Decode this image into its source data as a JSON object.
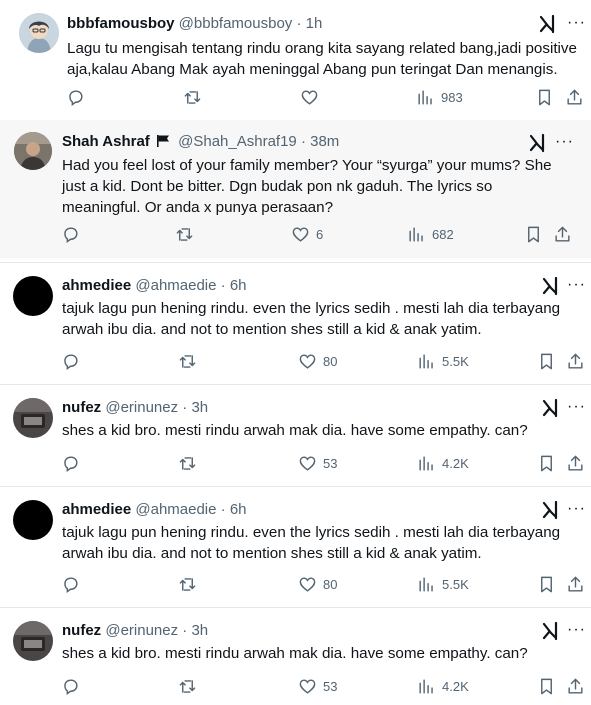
{
  "tweets": [
    {
      "name": "bbbfamousboy",
      "handle": "@bbbfamousboy",
      "time": "1h",
      "lines": [
        "Lagu tu mengisah tentang rindu orang kita sayang related bang,jadi positive",
        "aja,kalau Abang Mak ayah meninggal Abang pun teringat Dan menangis."
      ],
      "likes": "",
      "views": "983"
    },
    {
      "name": "Shah Ashraf",
      "handle": "@Shah_Ashraf19",
      "time": "38m",
      "lines": [
        "Had you feel lost of your family member? Your “syurga” your mums? She",
        "just a kid. Dont be bitter. Dgn budak pon nk gaduh. The lyrics so",
        "meaningful. Or anda x punya perasaan?"
      ],
      "likes": "6",
      "views": "682"
    },
    {
      "name": "ahmediee",
      "handle": "@ahmaedie",
      "time": "6h",
      "lines": [
        "tajuk lagu pun hening rindu. even the lyrics sedih . mesti lah dia terbayang",
        "arwah ibu dia. and not to mention shes still a kid & anak yatim."
      ],
      "likes": "80",
      "views": "5.5K"
    },
    {
      "name": "nufez",
      "handle": "@erinunez",
      "time": "3h",
      "lines": [
        "shes a kid bro. mesti rindu arwah mak dia. have some empathy. can?"
      ],
      "likes": "53",
      "views": "4.2K"
    },
    {
      "name": "ahmediee",
      "handle": "@ahmaedie",
      "time": "6h",
      "lines": [
        "tajuk lagu pun hening rindu. even the lyrics sedih . mesti lah dia terbayang",
        "arwah ibu dia. and not to mention shes still a kid & anak yatim."
      ],
      "likes": "80",
      "views": "5.5K"
    },
    {
      "name": "nufez",
      "handle": "@erinunez",
      "time": "3h",
      "lines": [
        "shes a kid bro. mesti rindu arwah mak dia. have some empathy. can?"
      ],
      "likes": "53",
      "views": "4.2K"
    }
  ],
  "separator": "·",
  "more_symbol": "···",
  "icons": {
    "reply": "reply-icon",
    "retweet": "retweet-icon",
    "like": "like-icon",
    "views": "views-icon",
    "bookmark": "bookmark-icon",
    "share": "share-icon",
    "grok": "grok-icon",
    "more": "more-icon",
    "flag": "flag-icon"
  },
  "colors": {
    "text": "#0f1419",
    "secondary": "#536471",
    "shaded_bg": "#f7f7f7",
    "divider": "#e6e6e6"
  }
}
